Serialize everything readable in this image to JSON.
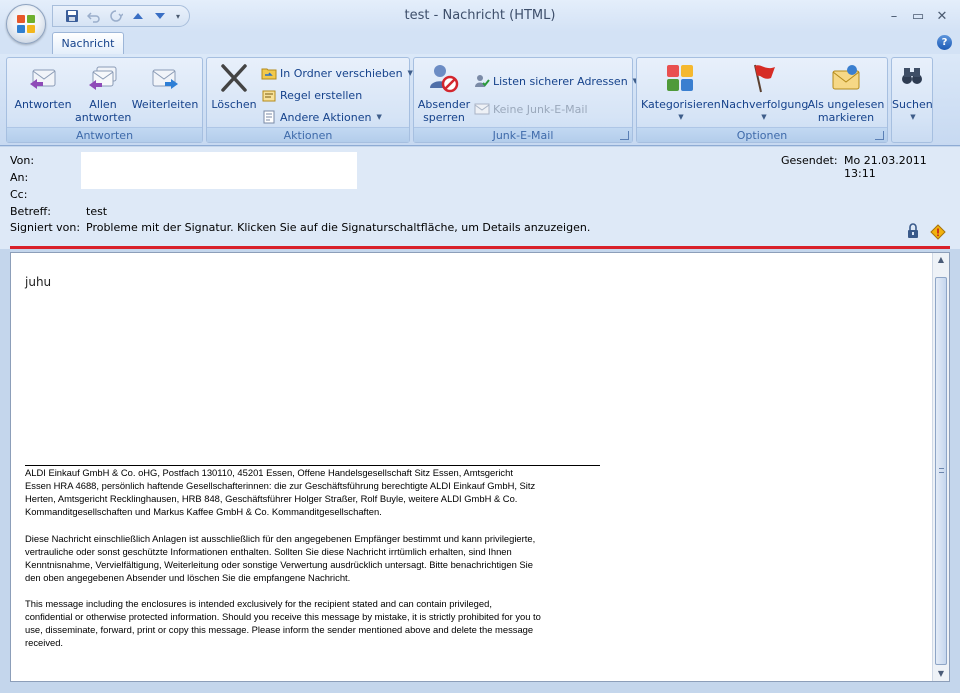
{
  "window": {
    "title": "test - Nachricht (HTML)",
    "controls": {
      "minimize": "–",
      "maximize": "▭",
      "close": "✕"
    }
  },
  "quick_access": [
    "save-icon",
    "undo-icon",
    "redo-icon",
    "previous-item-icon",
    "next-item-icon",
    "customize-icon"
  ],
  "tabs": [
    {
      "label": "Nachricht"
    }
  ],
  "ribbon": {
    "groups": {
      "respond": {
        "label": "Antworten",
        "buttons": {
          "reply": "Antworten",
          "reply_all_1": "Allen",
          "reply_all_2": "antworten",
          "forward": "Weiterleiten"
        }
      },
      "actions": {
        "label": "Aktionen",
        "delete": "Löschen",
        "move_to_folder": "In Ordner verschieben",
        "create_rule": "Regel erstellen",
        "other_actions": "Andere Aktionen"
      },
      "junk": {
        "label": "Junk-E-Mail",
        "block_sender_1": "Absender",
        "block_sender_2": "sperren",
        "safe_lists": "Listen sicherer Adressen",
        "not_junk": "Keine Junk-E-Mail"
      },
      "options": {
        "label": "Optionen",
        "categorize": "Kategorisieren",
        "follow_up": "Nachverfolgung",
        "mark_unread_1": "Als ungelesen",
        "mark_unread_2": "markieren"
      },
      "find": {
        "label": "Suchen"
      }
    }
  },
  "header": {
    "from_label": "Von:",
    "to_label": "An:",
    "cc_label": "Cc:",
    "subject_label": "Betreff:",
    "subject": "test",
    "signed_label": "Signiert von:",
    "signed_value": "Probleme mit der Signatur. Klicken Sie auf die Signaturschaltfläche, um Details anzuzeigen.",
    "sent_label": "Gesendet:",
    "sent_value": "Mo 21.03.2011 13:11"
  },
  "body": {
    "greeting": "juhu",
    "disclaimer": [
      [
        "ALDI Einkauf GmbH & Co. oHG, Postfach 130110, 45201 Essen, Offene Handelsgesellschaft Sitz Essen, Amtsgericht",
        "Essen HRA 4688, persönlich haftende Gesellschafterinnen: die zur Geschäftsführung berechtigte ALDI Einkauf GmbH, Sitz",
        "Herten, Amtsgericht Recklinghausen, HRB 848, Geschäftsführer Holger Straßer, Rolf Buyle, weitere ALDI GmbH & Co.",
        "Kommanditgesellschaften und Markus Kaffee GmbH & Co. Kommanditgesellschaften."
      ],
      [
        "Diese Nachricht einschließlich Anlagen ist ausschließlich für den angegebenen Empfänger bestimmt und kann privilegierte,",
        "vertrauliche oder sonst geschützte Informationen enthalten. Sollten Sie diese Nachricht irrtümlich erhalten, sind Ihnen",
        "Kenntnisnahme, Vervielfältigung, Weiterleitung oder sonstige Verwertung ausdrücklich untersagt. Bitte benachrichtigen Sie",
        "den oben angegebenen Absender und löschen Sie die empfangene Nachricht."
      ],
      [
        "This message including the enclosures is intended exclusively for the recipient stated and can contain privileged,",
        "confidential or otherwise protected information. Should you receive this message by mistake, it is strictly prohibited for you to",
        "use, disseminate, forward, print or copy this message. Please inform the sender mentioned above and delete the message",
        "received."
      ]
    ]
  }
}
